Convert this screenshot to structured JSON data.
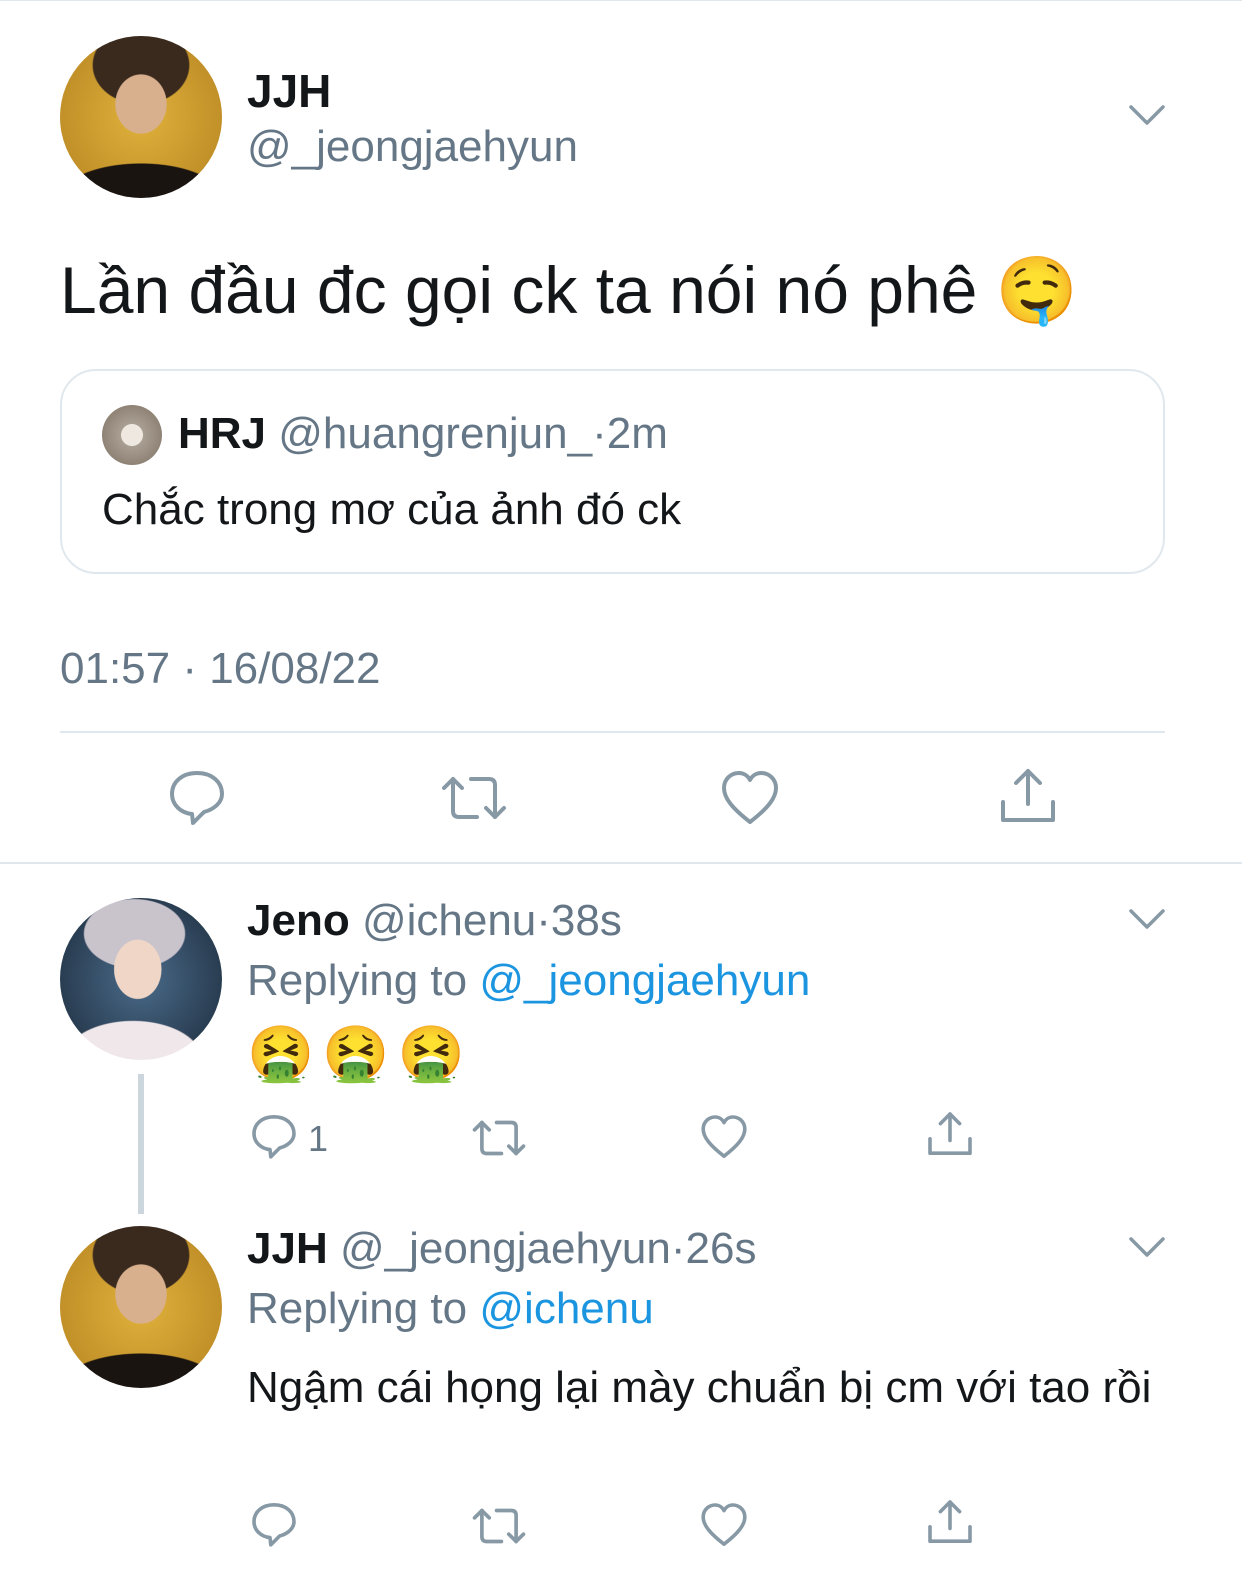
{
  "main_tweet": {
    "display_name": "JJH",
    "handle": "@_jeongjaehyun",
    "text": "Lần đầu đc gọi ck ta nói nó phê",
    "emoji": "🤤",
    "timestamp": "01:57 · 16/08/22",
    "quoted": {
      "display_name": "HRJ",
      "handle": "@huangrenjun_",
      "dot": "·",
      "time": "2m",
      "text": "Chắc trong mơ của ảnh đó ck"
    }
  },
  "replies": [
    {
      "display_name": "Jeno",
      "handle": "@ichenu",
      "dot": "·",
      "time": "38s",
      "replying_label": "Replying to",
      "replying_handle": "@_jeongjaehyun",
      "text": "🤮🤮🤮",
      "reply_count": "1"
    },
    {
      "display_name": "JJH",
      "handle": "@_jeongjaehyun",
      "dot": "·",
      "time": "26s",
      "replying_label": "Replying to",
      "replying_handle": "@ichenu",
      "text": "Ngậm cái họng lại mày chuẩn bị cm với tao rồi",
      "reply_count": ""
    }
  ],
  "icons": {
    "reply": "reply-icon",
    "retweet": "retweet-icon",
    "like": "heart-icon",
    "share": "share-icon",
    "more": "chevron-down-icon"
  },
  "colors": {
    "text": "#14171a",
    "secondary": "#657786",
    "link": "#1b95e0",
    "border": "#e1e8ed"
  }
}
